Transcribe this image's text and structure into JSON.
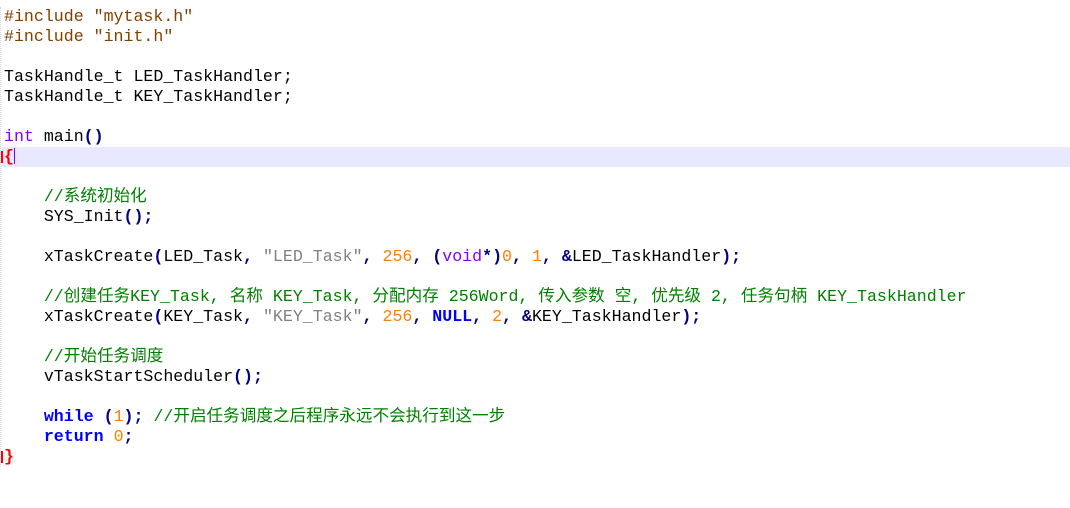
{
  "editor": {
    "current_line_index": 7,
    "lines": [
      [
        {
          "t": "pre",
          "v": "#include \"mytask.h\""
        }
      ],
      [
        {
          "t": "pre",
          "v": "#include \"init.h\""
        }
      ],
      [],
      [
        {
          "t": "plain",
          "v": "TaskHandle_t LED_TaskHandler;"
        }
      ],
      [
        {
          "t": "plain",
          "v": "TaskHandle_t KEY_TaskHandler;"
        }
      ],
      [],
      [
        {
          "t": "type",
          "v": "int"
        },
        {
          "t": "plain",
          "v": " main"
        },
        {
          "t": "op",
          "v": "()"
        }
      ],
      [
        {
          "t": "brace",
          "v": "{"
        }
      ],
      [],
      [
        {
          "t": "plain",
          "v": "    "
        },
        {
          "t": "com",
          "v": "//系统初始化"
        }
      ],
      [
        {
          "t": "plain",
          "v": "    SYS_Init"
        },
        {
          "t": "op",
          "v": "();"
        }
      ],
      [],
      [
        {
          "t": "plain",
          "v": "    xTaskCreate"
        },
        {
          "t": "op",
          "v": "("
        },
        {
          "t": "plain",
          "v": "LED_Task"
        },
        {
          "t": "op",
          "v": ","
        },
        {
          "t": "plain",
          "v": " "
        },
        {
          "t": "str",
          "v": "\"LED_Task\""
        },
        {
          "t": "op",
          "v": ","
        },
        {
          "t": "plain",
          "v": " "
        },
        {
          "t": "num",
          "v": "256"
        },
        {
          "t": "op",
          "v": ","
        },
        {
          "t": "plain",
          "v": " "
        },
        {
          "t": "op",
          "v": "("
        },
        {
          "t": "type",
          "v": "void"
        },
        {
          "t": "op",
          "v": "*)"
        },
        {
          "t": "num",
          "v": "0"
        },
        {
          "t": "op",
          "v": ","
        },
        {
          "t": "plain",
          "v": " "
        },
        {
          "t": "num",
          "v": "1"
        },
        {
          "t": "op",
          "v": ","
        },
        {
          "t": "plain",
          "v": " "
        },
        {
          "t": "op",
          "v": "&"
        },
        {
          "t": "plain",
          "v": "LED_TaskHandler"
        },
        {
          "t": "op",
          "v": ");"
        }
      ],
      [],
      [
        {
          "t": "plain",
          "v": "    "
        },
        {
          "t": "com",
          "v": "//创建任务KEY_Task, 名称 KEY_Task, 分配内存 256Word, 传入参数 空, 优先级 2, 任务句柄 KEY_TaskHandler"
        }
      ],
      [
        {
          "t": "plain",
          "v": "    xTaskCreate"
        },
        {
          "t": "op",
          "v": "("
        },
        {
          "t": "plain",
          "v": "KEY_Task"
        },
        {
          "t": "op",
          "v": ","
        },
        {
          "t": "plain",
          "v": " "
        },
        {
          "t": "str",
          "v": "\"KEY_Task\""
        },
        {
          "t": "op",
          "v": ","
        },
        {
          "t": "plain",
          "v": " "
        },
        {
          "t": "num",
          "v": "256"
        },
        {
          "t": "op",
          "v": ","
        },
        {
          "t": "plain",
          "v": " "
        },
        {
          "t": "kw",
          "v": "NULL"
        },
        {
          "t": "op",
          "v": ","
        },
        {
          "t": "plain",
          "v": " "
        },
        {
          "t": "num",
          "v": "2"
        },
        {
          "t": "op",
          "v": ","
        },
        {
          "t": "plain",
          "v": " "
        },
        {
          "t": "op",
          "v": "&"
        },
        {
          "t": "plain",
          "v": "KEY_TaskHandler"
        },
        {
          "t": "op",
          "v": ");"
        }
      ],
      [],
      [
        {
          "t": "plain",
          "v": "    "
        },
        {
          "t": "com",
          "v": "//开始任务调度"
        }
      ],
      [
        {
          "t": "plain",
          "v": "    vTaskStartScheduler"
        },
        {
          "t": "op",
          "v": "();"
        }
      ],
      [],
      [
        {
          "t": "plain",
          "v": "    "
        },
        {
          "t": "kw",
          "v": "while"
        },
        {
          "t": "plain",
          "v": " "
        },
        {
          "t": "op",
          "v": "("
        },
        {
          "t": "num",
          "v": "1"
        },
        {
          "t": "op",
          "v": ");"
        },
        {
          "t": "plain",
          "v": " "
        },
        {
          "t": "com",
          "v": "//开启任务调度之后程序永远不会执行到这一步"
        }
      ],
      [
        {
          "t": "plain",
          "v": "    "
        },
        {
          "t": "kw",
          "v": "return"
        },
        {
          "t": "plain",
          "v": " "
        },
        {
          "t": "num",
          "v": "0"
        },
        {
          "t": "op",
          "v": ";"
        }
      ],
      [
        {
          "t": "brace",
          "v": "}"
        }
      ]
    ]
  }
}
